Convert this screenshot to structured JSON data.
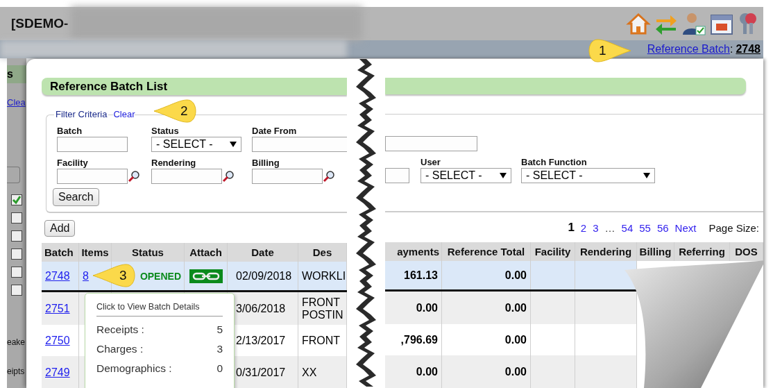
{
  "header": {
    "title": "[SDEMO-",
    "reference_batch": {
      "link": "Reference Batch",
      "separator": ":",
      "value": "2748"
    }
  },
  "sidebar": {
    "heading": "s",
    "link": "Clea",
    "checkboxes": [
      {
        "checked": true
      },
      {
        "checked": false
      },
      {
        "checked": false
      },
      {
        "checked": false
      },
      {
        "checked": false
      },
      {
        "checked": false
      }
    ],
    "labels": [
      "eake",
      "eipts"
    ]
  },
  "panel": {
    "title": "Reference Batch List",
    "filter": {
      "legend": "Filter Criteria",
      "clear_link": "Clear",
      "left_rows": [
        [
          {
            "kind": "text",
            "label": "Batch"
          },
          {
            "kind": "select",
            "label": "Status",
            "value": "- SELECT -"
          },
          {
            "kind": "text",
            "label": "Date From"
          }
        ],
        [
          {
            "kind": "lookup",
            "label": "Facility"
          },
          {
            "kind": "lookup",
            "label": "Rendering"
          },
          {
            "kind": "lookup",
            "label": "Billing"
          }
        ]
      ],
      "right_rows": [
        [
          {
            "kind": "text"
          }
        ],
        [
          {
            "kind": "text"
          },
          {
            "kind": "select",
            "label": "User",
            "value": "- SELECT -"
          },
          {
            "kind": "select",
            "label": "Batch Function",
            "value": "- SELECT -"
          }
        ]
      ],
      "search_button": "Search"
    },
    "add_button": "Add",
    "pagination": {
      "pages_before": [
        {
          "label": "1",
          "selected": true
        },
        {
          "label": "2",
          "selected": false
        },
        {
          "label": "3",
          "selected": false
        }
      ],
      "ellipsis": "…",
      "pages_after": [
        {
          "label": "54",
          "selected": false
        },
        {
          "label": "55",
          "selected": false
        },
        {
          "label": "56",
          "selected": false
        }
      ],
      "next": "Next",
      "page_size_label": "Page Size:"
    },
    "table": {
      "left_columns": [
        "Batch",
        "Items",
        "Status",
        "Attach",
        "Date",
        "Des"
      ],
      "right_columns": [
        "ayments",
        "Reference Total",
        "Facility",
        "Rendering",
        "Billing",
        "Referring",
        "DOS"
      ],
      "rows": [
        {
          "selected": true,
          "batch": "2748",
          "items": "8",
          "status": "OPENED",
          "attachment": true,
          "date": "02/09/2018",
          "description": [
            "WORKLI"
          ],
          "payments": "161.13",
          "reference_total": "0.00"
        },
        {
          "selected": false,
          "batch": "2751",
          "date": "3/06/2018",
          "description": [
            "FRONT",
            "POSTIN"
          ],
          "payments": "0.00",
          "reference_total": "0.00"
        },
        {
          "selected": false,
          "batch": "2750",
          "date": "2/13/2017",
          "description": [
            "FRONT"
          ],
          "payments": ",796.69",
          "reference_total": "0.00"
        },
        {
          "selected": false,
          "batch": "2749",
          "date": "0/31/2017",
          "description": [
            "XX"
          ],
          "payments": "0.00",
          "reference_total": "0.00"
        }
      ]
    },
    "tooltip": {
      "title": "Click to View Batch Details",
      "rows": [
        {
          "label": "Receipts :",
          "value": "5"
        },
        {
          "label": "Charges :",
          "value": "3"
        },
        {
          "label": "Demographics :",
          "value": "0"
        }
      ]
    }
  },
  "callouts": [
    "1",
    "2",
    "3"
  ]
}
